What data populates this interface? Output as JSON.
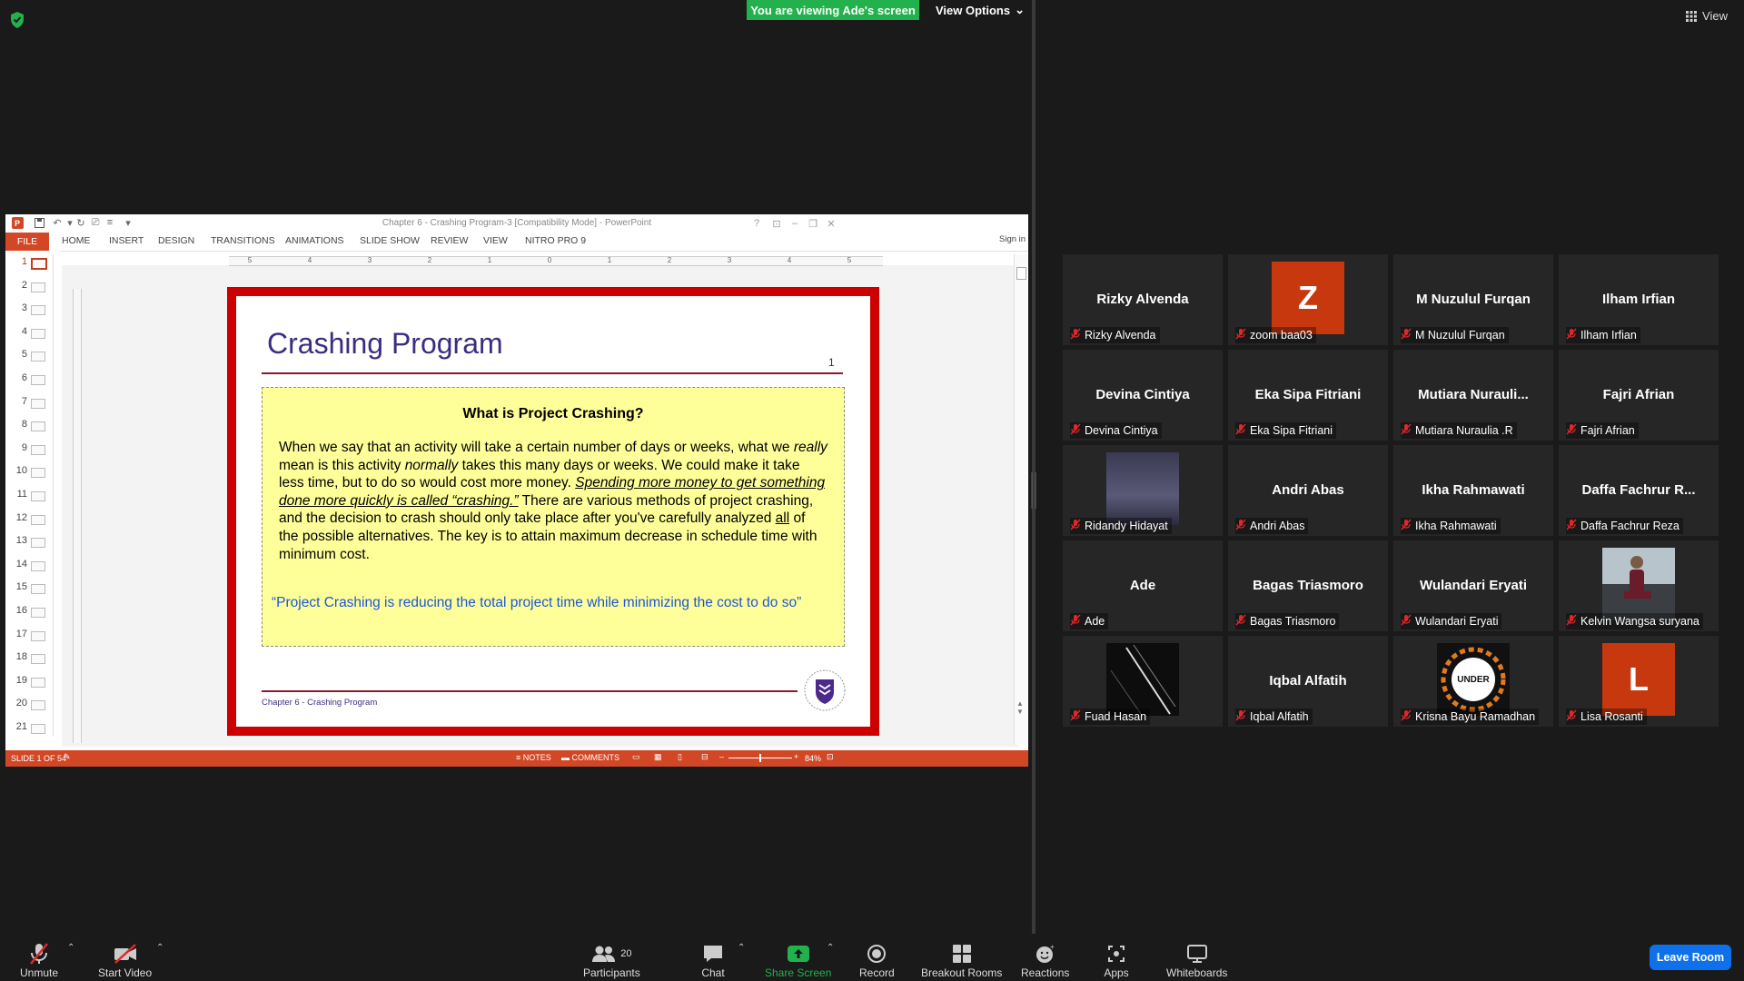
{
  "top": {
    "banner": "You are viewing Ade's screen",
    "view_options": "View Options",
    "view": "View"
  },
  "ppt": {
    "window_title": "Chapter 6 - Crashing Program-3 [Compatibility Mode] - PowerPoint",
    "sign_in": "Sign in",
    "tabs": [
      "FILE",
      "HOME",
      "INSERT",
      "DESIGN",
      "TRANSITIONS",
      "ANIMATIONS",
      "SLIDE SHOW",
      "REVIEW",
      "VIEW",
      "NITRO PRO 9"
    ],
    "ruler": [
      "5",
      "4",
      "3",
      "2",
      "1",
      "0",
      "1",
      "2",
      "3",
      "4",
      "5"
    ],
    "thumbnail_numbers": [
      "1",
      "2",
      "3",
      "4",
      "5",
      "6",
      "7",
      "8",
      "9",
      "10",
      "11",
      "12",
      "13",
      "14",
      "15",
      "16",
      "17",
      "18",
      "19",
      "20",
      "21"
    ],
    "status": {
      "slide": "SLIDE 1 OF 54",
      "notes": "NOTES",
      "comments": "COMMENTS",
      "zoom": "84%"
    },
    "slide": {
      "title": "Crashing Program",
      "page_number": "1",
      "box_heading": "What is Project Crashing?",
      "p1": "When we say that an activity will take a certain number of days or weeks, what we ",
      "p_really": "really",
      "p2": " mean is this activity ",
      "p_normally": "normally",
      "p3": " takes this many days or weeks. We could make it take less time, but to do so would cost more money. ",
      "p_def": "Spending more money to get something done more quickly is called “crashing.”",
      "p4": " There are various methods of project crashing, and the decision to crash should only take place after you've carefully analyzed ",
      "p_all": "all",
      "p5": " of the possible alternatives. The key is to attain maximum decrease in schedule time with minimum cost.",
      "quote": "“Project Crashing is reducing the total project time while minimizing the cost to do so”",
      "footer": "Chapter 6 - Crashing Program"
    }
  },
  "gallery": [
    {
      "big": "Rizky Alvenda",
      "name": "Rizky Alvenda",
      "avatar": "",
      "avatar_color": ""
    },
    {
      "big": "",
      "name": "zoom baa03",
      "avatar": "Z",
      "avatar_color": "#c8380f"
    },
    {
      "big": "M Nuzulul Furqan",
      "name": "M Nuzulul Furqan",
      "avatar": "",
      "avatar_color": ""
    },
    {
      "big": "Ilham Irfian",
      "name": "Ilham Irfian",
      "avatar": "",
      "avatar_color": ""
    },
    {
      "big": "Devina Cintiya",
      "name": "Devina Cintiya",
      "avatar": "",
      "avatar_color": ""
    },
    {
      "big": "Eka Sipa Fitriani",
      "name": "Eka Sipa Fitriani",
      "avatar": "",
      "avatar_color": ""
    },
    {
      "big": "Mutiara  Nurauli...",
      "name": "Mutiara Nuraulia .R",
      "avatar": "",
      "avatar_color": ""
    },
    {
      "big": "Fajri Afrian",
      "name": "Fajri Afrian",
      "avatar": "",
      "avatar_color": ""
    },
    {
      "big": "",
      "name": "Ridandy Hidayat",
      "avatar": "photo-night",
      "avatar_color": ""
    },
    {
      "big": "Andri Abas",
      "name": "Andri Abas",
      "avatar": "",
      "avatar_color": ""
    },
    {
      "big": "Ikha Rahmawati",
      "name": "Ikha Rahmawati",
      "avatar": "",
      "avatar_color": ""
    },
    {
      "big": "Daffa Fachrur R...",
      "name": "Daffa Fachrur Reza",
      "avatar": "",
      "avatar_color": ""
    },
    {
      "big": "Ade",
      "name": "Ade",
      "avatar": "",
      "avatar_color": ""
    },
    {
      "big": "Bagas Triasmoro",
      "name": "Bagas Triasmoro",
      "avatar": "",
      "avatar_color": ""
    },
    {
      "big": "Wulandari Eryati",
      "name": "Wulandari Eryati",
      "avatar": "",
      "avatar_color": ""
    },
    {
      "big": "",
      "name": "Kelvin Wangsa suryana",
      "avatar": "photo-person",
      "avatar_color": ""
    },
    {
      "big": "",
      "name": "Fuad Hasan",
      "avatar": "photo-dark",
      "avatar_color": ""
    },
    {
      "big": "Iqbal Alfatih",
      "name": "Iqbal Alfatih",
      "avatar": "",
      "avatar_color": ""
    },
    {
      "big": "",
      "name": "Krisna Bayu Ramadhan",
      "avatar": "photo-under",
      "avatar_color": ""
    },
    {
      "big": "",
      "name": "Lisa Rosanti",
      "avatar": "L",
      "avatar_color": "#c8380f"
    }
  ],
  "under_badge": "UNDER",
  "toolbar": {
    "unmute": "Unmute",
    "start_video": "Start Video",
    "participants": "Participants",
    "participants_count": "20",
    "chat": "Chat",
    "share_screen": "Share Screen",
    "record": "Record",
    "breakout_rooms": "Breakout Rooms",
    "reactions": "Reactions",
    "apps": "Apps",
    "whiteboards": "Whiteboards",
    "leave": "Leave Room"
  },
  "colors": {
    "share_green": "#22b14c",
    "ppt_orange": "#d24726",
    "slide_border": "#cc0000",
    "leave_blue": "#0e71eb",
    "muted_red": "#e02828"
  }
}
